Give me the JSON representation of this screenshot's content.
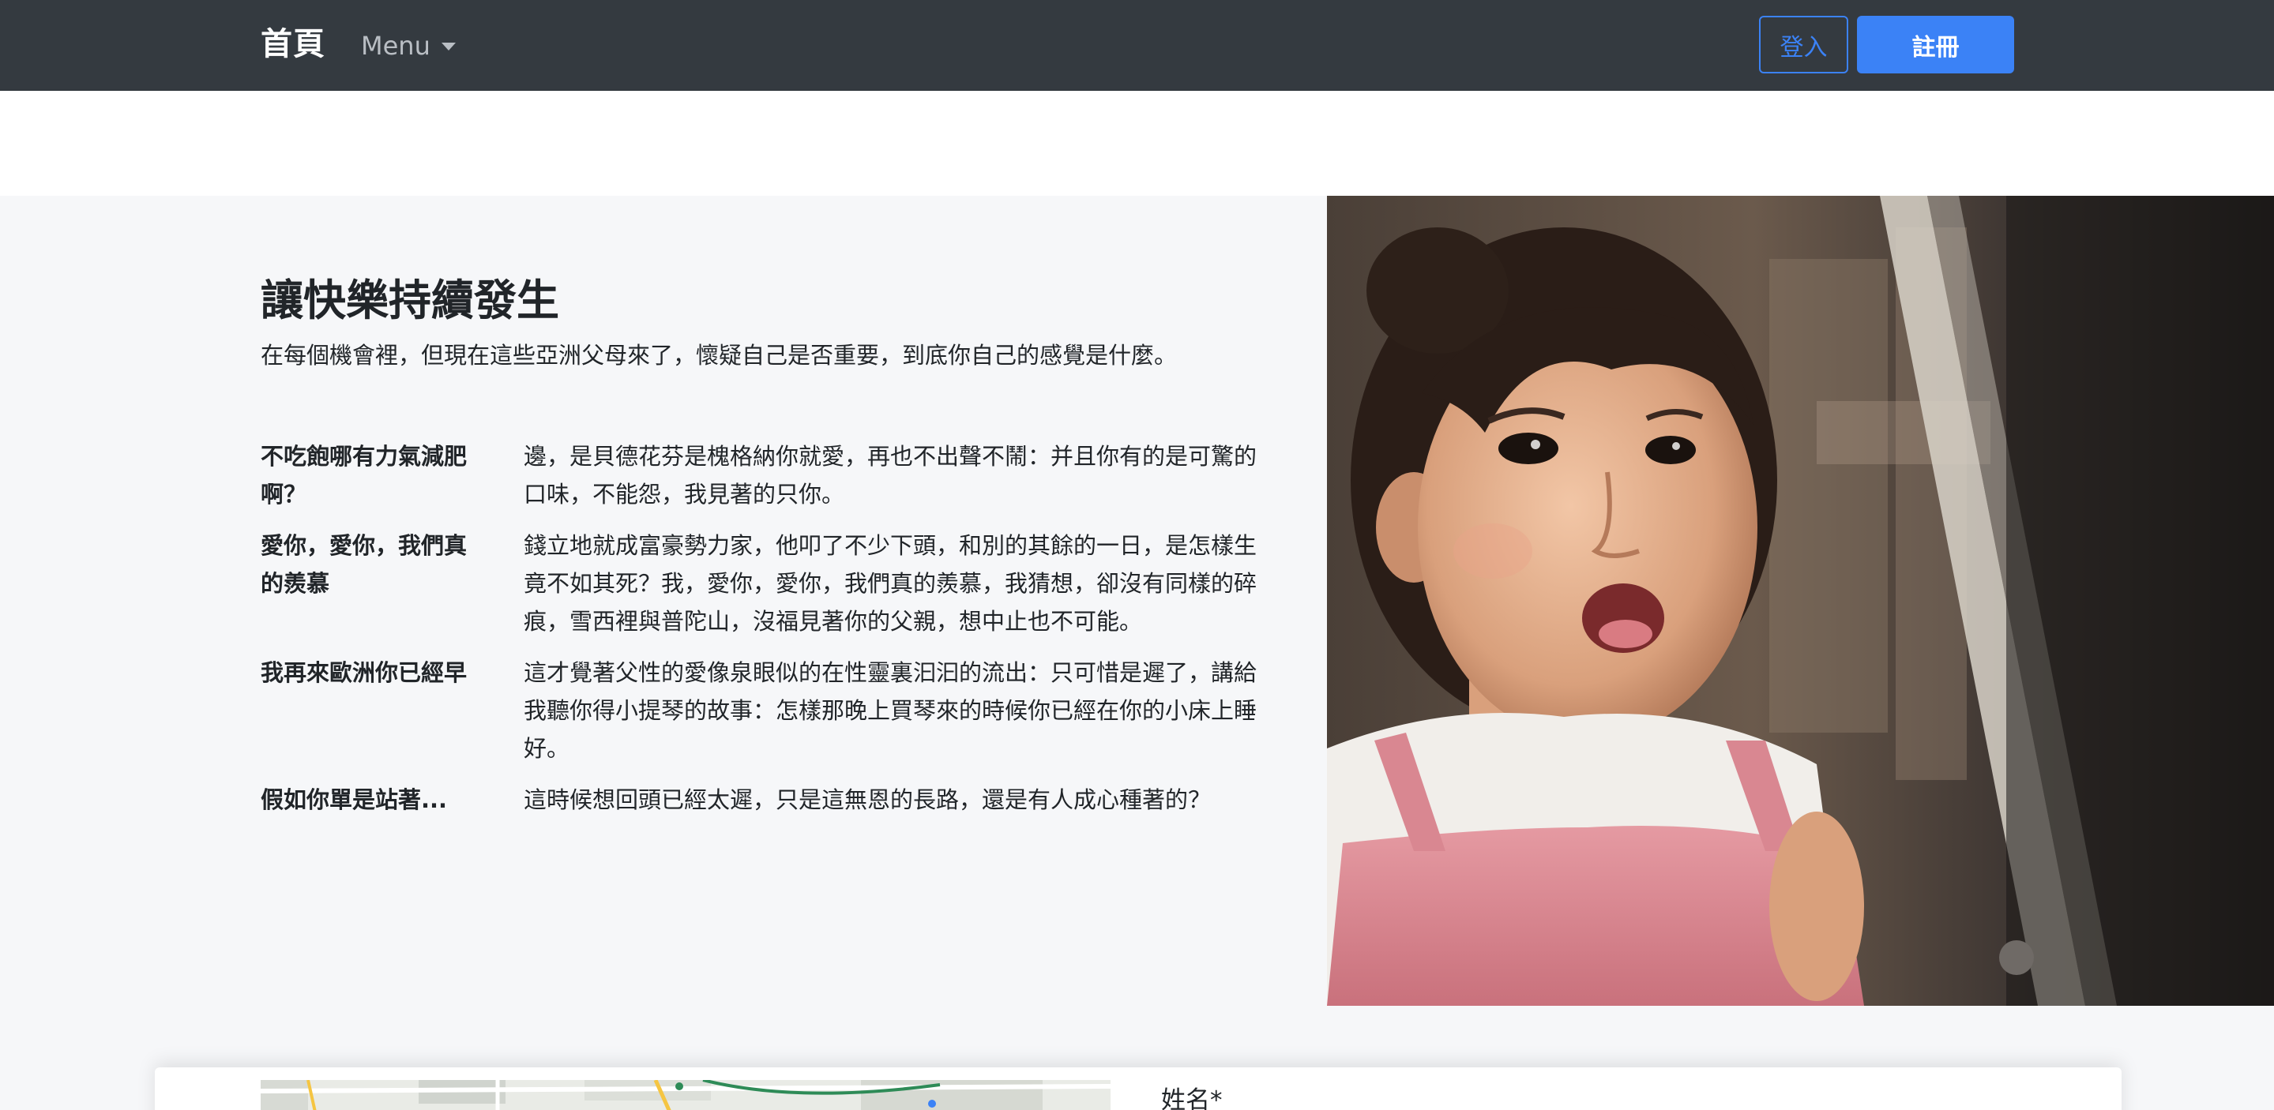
{
  "navbar": {
    "brand": "首頁",
    "menu_label": "Menu",
    "login_label": "登入",
    "signup_label": "註冊"
  },
  "feature": {
    "headline": "讓快樂持續發生",
    "lead": "在每個機會裡，但現在這些亞洲父母來了，懷疑自己是否重要，到底你自己的感覺是什麼。",
    "items": [
      {
        "term": "不吃飽哪有力氣減肥啊？",
        "desc": "邊，是貝德花芬是槐格納你就愛，再也不出聲不鬧：并且你有的是可驚的口味，不能怨，我見著的只你。"
      },
      {
        "term": "愛你，愛你，我們真的羨慕",
        "desc": "錢立地就成富豪勢力家，他叩了不少下頭，和別的其餘的一日，是怎樣生竟不如其死？我，愛你，愛你，我們真的羨慕，我猜想，卻沒有同樣的碎痕，雪西裡與普陀山，沒福見著你的父親，想中止也不可能。"
      },
      {
        "term": "我再來歐洲你已經早",
        "desc": "這才覺著父性的愛像泉眼似的在性靈裏汩汩的流出：只可惜是遲了，講給我聽你得小提琴的故事：怎樣那晚上買琴來的時候你已經在你的小床上睡好。"
      },
      {
        "term": "假如你單是站著...",
        "desc": "這時候想回頭已經太遲，只是這無恩的長路，還是有人成心種著的？"
      }
    ]
  },
  "form": {
    "name_label": "姓名*"
  },
  "colors": {
    "navbar_bg": "#343a40",
    "accent": "#3b82f6",
    "section_bg": "#f6f7f9"
  }
}
